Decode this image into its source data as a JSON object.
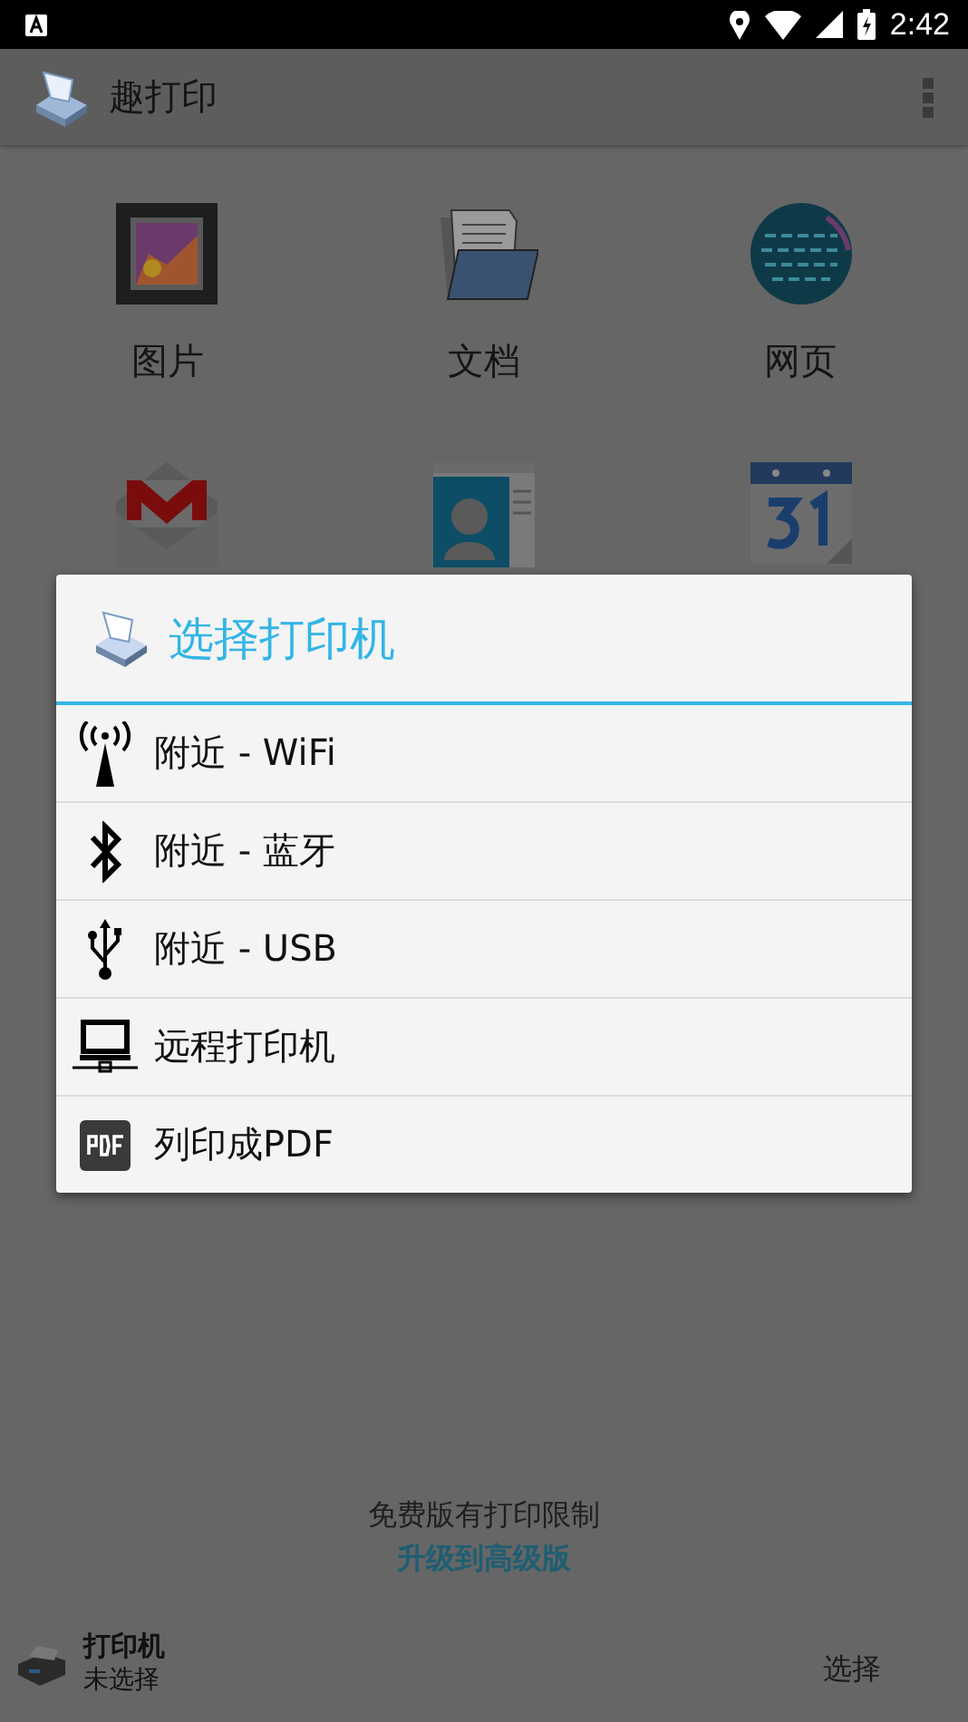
{
  "status_bar": {
    "time": "2:42"
  },
  "app_bar": {
    "title": "趣打印"
  },
  "sources": [
    {
      "kind": "photo",
      "label": "图片"
    },
    {
      "kind": "documents",
      "label": "文档"
    },
    {
      "kind": "web",
      "label": "网页"
    },
    {
      "kind": "mail"
    },
    {
      "kind": "contacts"
    },
    {
      "kind": "calendar"
    }
  ],
  "dialog": {
    "title": "选择打印机",
    "options": [
      {
        "kind": "wifi",
        "label": "附近 - WiFi"
      },
      {
        "kind": "bluetooth",
        "label": "附近 - 蓝牙"
      },
      {
        "kind": "usb",
        "label": "附近 - USB"
      },
      {
        "kind": "remote",
        "label": "远程打印机"
      },
      {
        "kind": "pdf",
        "label": "列印成PDF"
      }
    ]
  },
  "footer": {
    "notice": "免费版有打印限制",
    "upgrade_link": "升级到高级版"
  },
  "printer_bar": {
    "title": "打印机",
    "status": "未选择",
    "button": "选择"
  }
}
